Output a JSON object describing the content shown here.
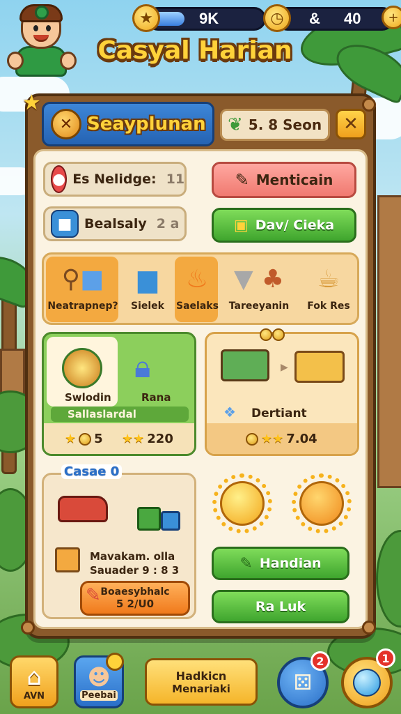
{
  "hud": {
    "energy_value": "9K",
    "energy_fill_fraction": 0.3,
    "star_icon": "star-icon",
    "coin_icon": "clock-coin-icon",
    "coins_value": "40",
    "multiplier_label": "&"
  },
  "game_title": "Casyal Harian",
  "panel": {
    "header_title": "Seayplunan",
    "season_label": "5. 8 Seon",
    "close_icon": "close-x-icon",
    "item_1": {
      "label": "Es Nelidge:",
      "count": "11"
    },
    "item_2": {
      "label": "Bealsaly",
      "count": "2 a"
    },
    "btn_mentioan": "Menticain",
    "btn_dav_cieka": "Dav/ Cieka"
  },
  "strip": {
    "items": [
      {
        "label": "Neatrapnep?",
        "icon": "telescope-icon"
      },
      {
        "label": "Sielek",
        "icon": "blue-tub-icon"
      },
      {
        "label": "Saelaks",
        "icon": "flame-icon"
      },
      {
        "label": "Tareeyanin",
        "icon": "cone-icon"
      },
      {
        "label": "Fok Res",
        "icon": "mug-icon"
      }
    ],
    "extra_icon": "potted-plant-icon"
  },
  "card_green": {
    "left_label": "Swlodin",
    "right_label": "Rana",
    "bar_label": "Sallaslardal",
    "coins_value": "5",
    "stars_value": "220"
  },
  "card_orange": {
    "title": "Dertiant",
    "value": "7.04"
  },
  "card_cream": {
    "tag": "Casae 0",
    "line_1": "Mavakam. olla",
    "line_2": "Sauader 9 : 8 3",
    "button_line_1": "Boaesybhalc",
    "button_line_2": "5 2/U0"
  },
  "right_buttons": {
    "handian": "Handian",
    "ra_luk": "Ra Luk"
  },
  "nav": {
    "home_label": "AVN",
    "profile_label": "Peebai",
    "profile_badge": "",
    "center_line_1": "Hadkicn",
    "center_line_2": "Menariaki",
    "dice_badge": "2",
    "orb_badge": "1"
  }
}
